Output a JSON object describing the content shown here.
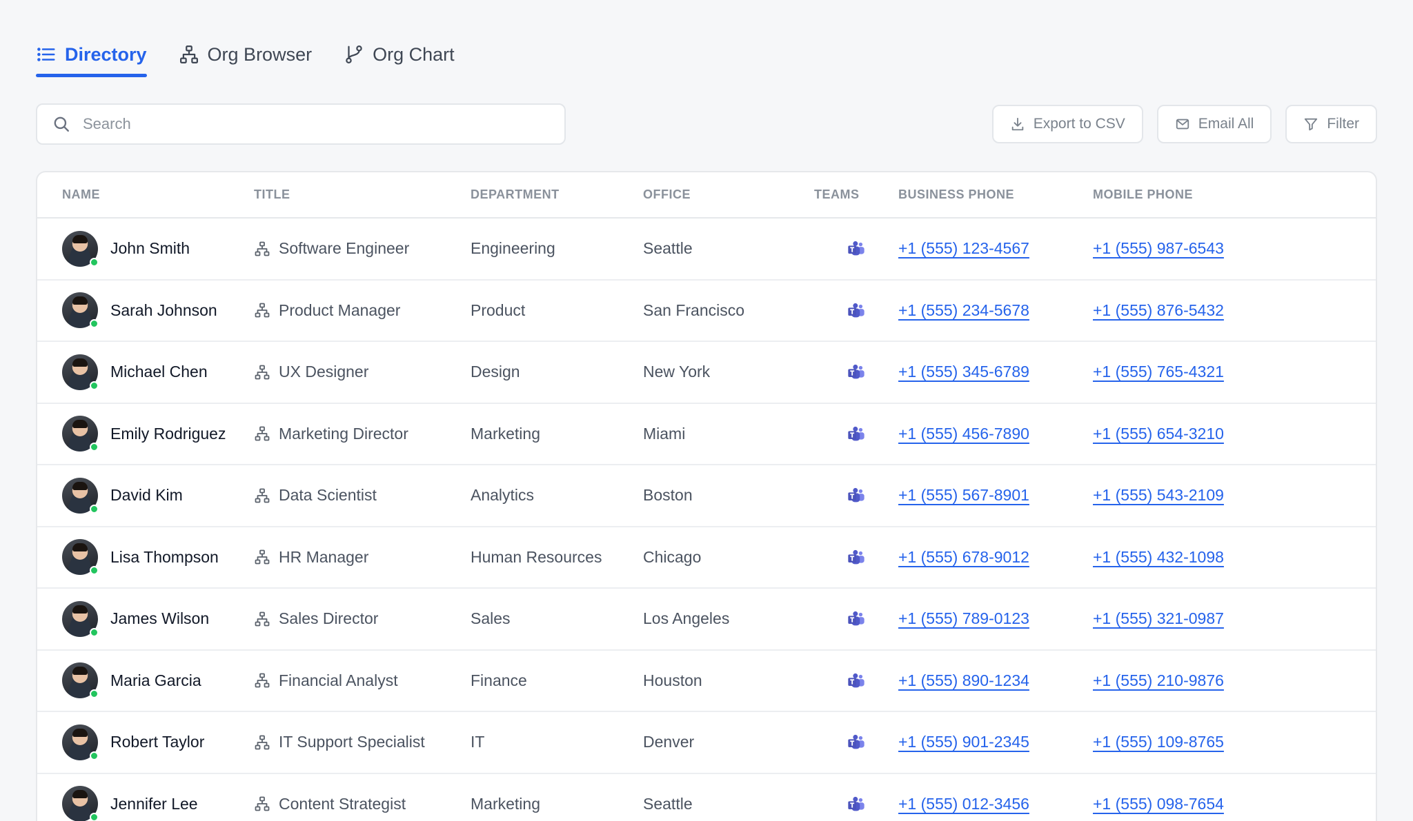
{
  "tabs": [
    {
      "label": "Directory",
      "icon": "list-icon",
      "active": true
    },
    {
      "label": "Org Browser",
      "icon": "org-tree-icon",
      "active": false
    },
    {
      "label": "Org Chart",
      "icon": "branch-icon",
      "active": false
    }
  ],
  "search": {
    "placeholder": "Search",
    "value": ""
  },
  "actions": {
    "export_label": "Export to CSV",
    "email_label": "Email All",
    "filter_label": "Filter"
  },
  "columns": {
    "name": "NAME",
    "title": "TITLE",
    "department": "DEPARTMENT",
    "office": "OFFICE",
    "teams": "TEAMS",
    "business_phone": "BUSINESS PHONE",
    "mobile_phone": "MOBILE PHONE"
  },
  "colors": {
    "accent": "#2563eb",
    "online": "#22c55e",
    "teams": "#5059c9"
  },
  "rows": [
    {
      "name": "John Smith",
      "title": "Software Engineer",
      "department": "Engineering",
      "office": "Seattle",
      "business_phone": "+1 (555) 123-4567",
      "mobile_phone": "+1 (555) 987-6543"
    },
    {
      "name": "Sarah Johnson",
      "title": "Product Manager",
      "department": "Product",
      "office": "San Francisco",
      "business_phone": "+1 (555) 234-5678",
      "mobile_phone": "+1 (555) 876-5432"
    },
    {
      "name": "Michael Chen",
      "title": "UX Designer",
      "department": "Design",
      "office": "New York",
      "business_phone": "+1 (555) 345-6789",
      "mobile_phone": "+1 (555) 765-4321"
    },
    {
      "name": "Emily Rodriguez",
      "title": "Marketing Director",
      "department": "Marketing",
      "office": "Miami",
      "business_phone": "+1 (555) 456-7890",
      "mobile_phone": "+1 (555) 654-3210"
    },
    {
      "name": "David Kim",
      "title": "Data Scientist",
      "department": "Analytics",
      "office": "Boston",
      "business_phone": "+1 (555) 567-8901",
      "mobile_phone": "+1 (555) 543-2109"
    },
    {
      "name": "Lisa Thompson",
      "title": "HR Manager",
      "department": "Human Resources",
      "office": "Chicago",
      "business_phone": "+1 (555) 678-9012",
      "mobile_phone": "+1 (555) 432-1098"
    },
    {
      "name": "James Wilson",
      "title": "Sales Director",
      "department": "Sales",
      "office": "Los Angeles",
      "business_phone": "+1 (555) 789-0123",
      "mobile_phone": "+1 (555) 321-0987"
    },
    {
      "name": "Maria Garcia",
      "title": "Financial Analyst",
      "department": "Finance",
      "office": "Houston",
      "business_phone": "+1 (555) 890-1234",
      "mobile_phone": "+1 (555) 210-9876"
    },
    {
      "name": "Robert Taylor",
      "title": "IT Support Specialist",
      "department": "IT",
      "office": "Denver",
      "business_phone": "+1 (555) 901-2345",
      "mobile_phone": "+1 (555) 109-8765"
    },
    {
      "name": "Jennifer Lee",
      "title": "Content Strategist",
      "department": "Marketing",
      "office": "Seattle",
      "business_phone": "+1 (555) 012-3456",
      "mobile_phone": "+1 (555) 098-7654"
    }
  ]
}
